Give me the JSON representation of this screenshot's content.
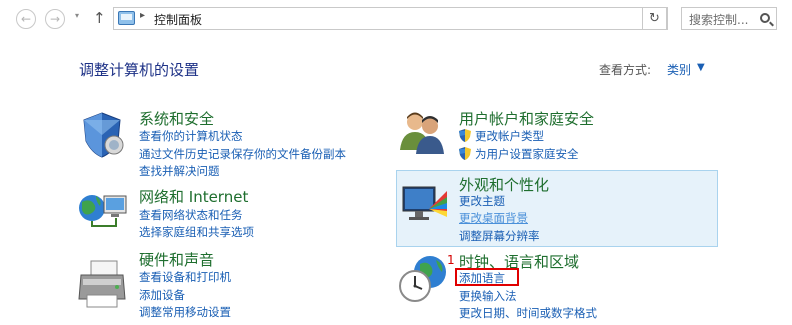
{
  "address_bar": {
    "back_arrow": "←",
    "forward_arrow": "→",
    "recent_arrow": "▾",
    "up_arrow": "↑",
    "separator": "▸",
    "path": "控制面板",
    "path_dropdown": "▾",
    "refresh_glyph": "↻",
    "search_placeholder": "搜索控制..."
  },
  "header": {
    "title": "调整计算机的设置",
    "view_by_label": "查看方式:",
    "view_by_value": "类别",
    "view_by_arrow": "▼"
  },
  "categories": {
    "system": {
      "title": "系统和安全",
      "links": [
        "查看你的计算机状态",
        "通过文件历史记录保存你的文件备份副本",
        "查找并解决问题"
      ]
    },
    "network": {
      "title": "网络和 Internet",
      "links": [
        "查看网络状态和任务",
        "选择家庭组和共享选项"
      ]
    },
    "hardware": {
      "title": "硬件和声音",
      "links": [
        "查看设备和打印机",
        "添加设备",
        "调整常用移动设置"
      ]
    },
    "users": {
      "title": "用户帐户和家庭安全",
      "links": [
        "更改帐户类型",
        "为用户设置家庭安全"
      ]
    },
    "appearance": {
      "title": "外观和个性化",
      "links": [
        "更改主题",
        "更改桌面背景",
        "调整屏幕分辨率"
      ]
    },
    "clock": {
      "title": "时钟、语言和区域",
      "links": [
        "添加语言",
        "更换输入法",
        "更改日期、时间或数字格式"
      ]
    }
  },
  "annotation": {
    "step_number": "1"
  },
  "colors": {
    "category_title": "#1e6e2e",
    "link": "#1a5fb4",
    "page_title": "#1e3287",
    "highlight_bg": "#e6f2fa",
    "annotation_red": "#e00000"
  }
}
